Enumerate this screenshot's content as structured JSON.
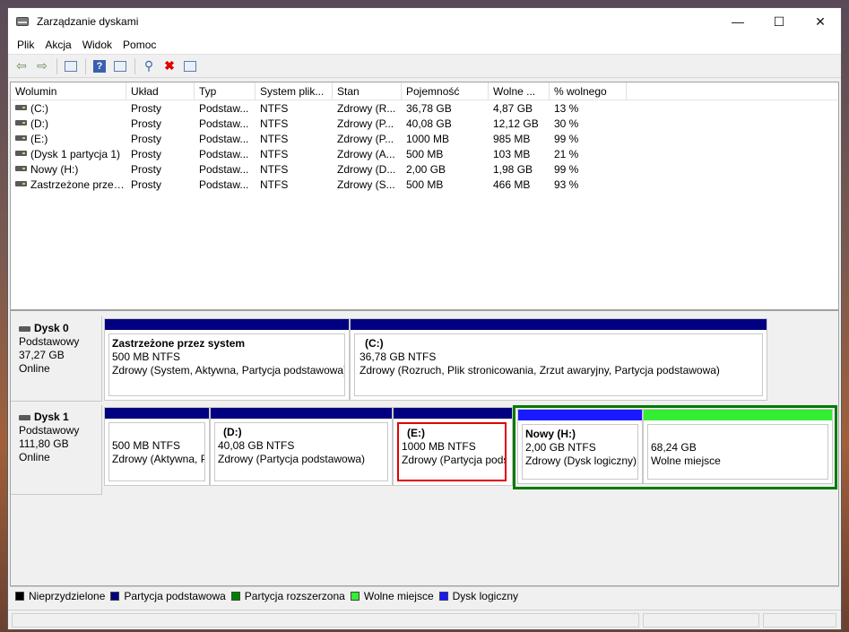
{
  "window": {
    "title": "Zarządzanie dyskami"
  },
  "menu": [
    "Plik",
    "Akcja",
    "Widok",
    "Pomoc"
  ],
  "toolbar": {
    "icons": [
      "back-arrow-icon",
      "forward-arrow-icon",
      "console-tree-icon",
      "help-icon",
      "properties-icon",
      "connect-icon",
      "delete-icon",
      "check-icon"
    ]
  },
  "table": {
    "headers": [
      "Wolumin",
      "Układ",
      "Typ",
      "System plik...",
      "Stan",
      "Pojemność",
      "Wolne ...",
      "% wolnego"
    ],
    "rows": [
      [
        "(C:)",
        "Prosty",
        "Podstaw...",
        "NTFS",
        "Zdrowy (R...",
        "36,78 GB",
        "4,87 GB",
        "13 %"
      ],
      [
        "(D:)",
        "Prosty",
        "Podstaw...",
        "NTFS",
        "Zdrowy (P...",
        "40,08 GB",
        "12,12 GB",
        "30 %"
      ],
      [
        "(E:)",
        "Prosty",
        "Podstaw...",
        "NTFS",
        "Zdrowy (P...",
        "1000 MB",
        "985 MB",
        "99 %"
      ],
      [
        "(Dysk 1 partycja 1)",
        "Prosty",
        "Podstaw...",
        "NTFS",
        "Zdrowy (A...",
        "500 MB",
        "103 MB",
        "21 %"
      ],
      [
        "Nowy (H:)",
        "Prosty",
        "Podstaw...",
        "NTFS",
        "Zdrowy (D...",
        "2,00 GB",
        "1,98 GB",
        "99 %"
      ],
      [
        "Zastrzeżone przez ...",
        "Prosty",
        "Podstaw...",
        "NTFS",
        "Zdrowy (S...",
        "500 MB",
        "466 MB",
        "93 %"
      ]
    ]
  },
  "disks": [
    {
      "name": "Dysk 0",
      "type": "Podstawowy",
      "size": "37,27 GB",
      "status": "Online",
      "partitions": [
        {
          "name": "Zastrzeżone przez system",
          "size": "500 MB NTFS",
          "status": "Zdrowy (System, Aktywna, Partycja podstawowa)"
        },
        {
          "name": "(C:)",
          "size": "36,78 GB NTFS",
          "status": "Zdrowy (Rozruch, Plik stronicowania, Zrzut awaryjny, Partycja podstawowa)"
        }
      ]
    },
    {
      "name": "Dysk 1",
      "type": "Podstawowy",
      "size": "111,80 GB",
      "status": "Online",
      "partitions": [
        {
          "name": "",
          "size": "500 MB NTFS",
          "status": "Zdrowy (Aktywna, Partycja podstawowa)"
        },
        {
          "name": "(D:)",
          "size": "40,08 GB NTFS",
          "status": "Zdrowy (Partycja podstawowa)"
        },
        {
          "name": "(E:)",
          "size": "1000 MB NTFS",
          "status": "Zdrowy (Partycja podstawowa)"
        },
        {
          "name": "Nowy  (H:)",
          "size": "2,00 GB NTFS",
          "status": "Zdrowy (Dysk logiczny)"
        },
        {
          "name": "",
          "size": "68,24 GB",
          "status": "Wolne miejsce"
        }
      ]
    }
  ],
  "legend": [
    {
      "label": "Nieprzydzielone",
      "color": "#000000"
    },
    {
      "label": "Partycja podstawowa",
      "color": "#000080"
    },
    {
      "label": "Partycja rozszerzona",
      "color": "#008000"
    },
    {
      "label": "Wolne miejsce",
      "color": "#33ee33"
    },
    {
      "label": "Dysk logiczny",
      "color": "#1a1aff"
    }
  ],
  "colors": {
    "primary": "#000080",
    "extended": "#008000",
    "free": "#33ee33",
    "logical": "#1a1aff",
    "highlight": "#e00000"
  }
}
